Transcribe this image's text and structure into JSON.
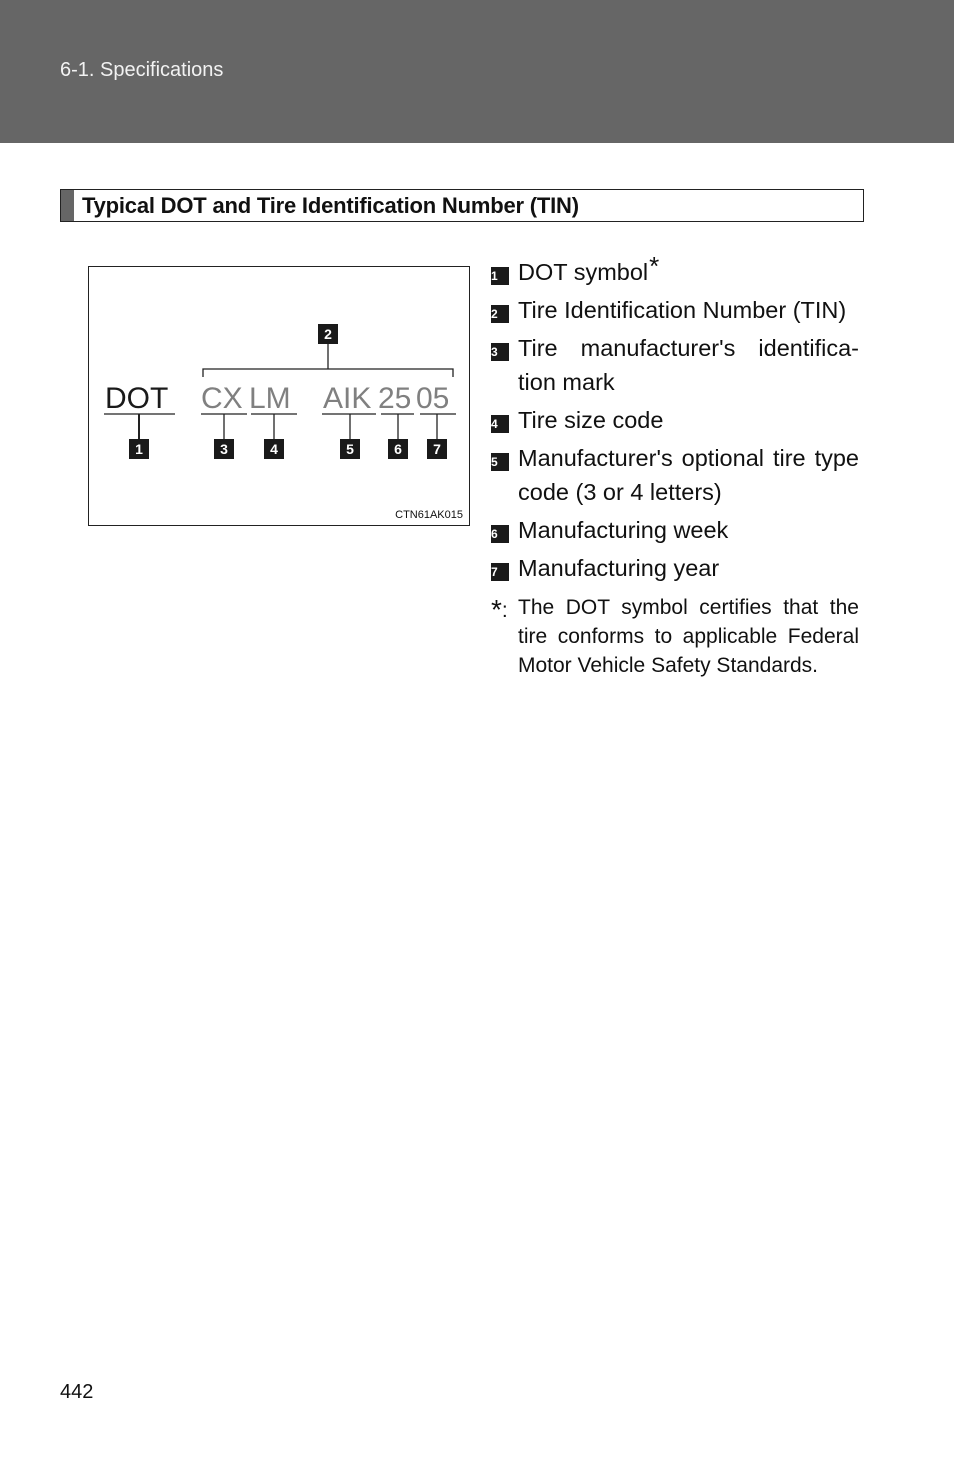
{
  "header": {
    "breadcrumb": "6-1. Specifications"
  },
  "section": {
    "title": "Typical DOT and Tire Identification Number (TIN)"
  },
  "figure": {
    "code": "CTN61AK015",
    "segments": {
      "dot": "DOT",
      "cx": "CX",
      "lm": "LM",
      "aik": "AIK",
      "week": "25",
      "year": "05"
    },
    "callouts": [
      "1",
      "2",
      "3",
      "4",
      "5",
      "6",
      "7"
    ],
    "colors": {
      "dot_text": "#1a1a1a",
      "tin_text": "#808080",
      "badge_bg": "#1a1a1a"
    }
  },
  "legend": {
    "items": [
      {
        "number": "1",
        "label": "DOT symbol",
        "footnote_marker": "*"
      },
      {
        "number": "2",
        "label": "Tire Identification Number (TIN)"
      },
      {
        "number": "3",
        "label": "Tire manufacturer's identifica- tion mark"
      },
      {
        "number": "4",
        "label": "Tire size code"
      },
      {
        "number": "5",
        "label": "Manufacturer's optional tire type code (3 or 4 letters)"
      },
      {
        "number": "6",
        "label": "Manufacturing week"
      },
      {
        "number": "7",
        "label": "Manufacturing year"
      }
    ],
    "footnote": {
      "marker": "*",
      "separator": ":",
      "text": "The DOT symbol certifies that the tire conforms to applicable Federal Motor Vehicle Safety Standards."
    }
  },
  "footer": {
    "page_number": "442"
  }
}
